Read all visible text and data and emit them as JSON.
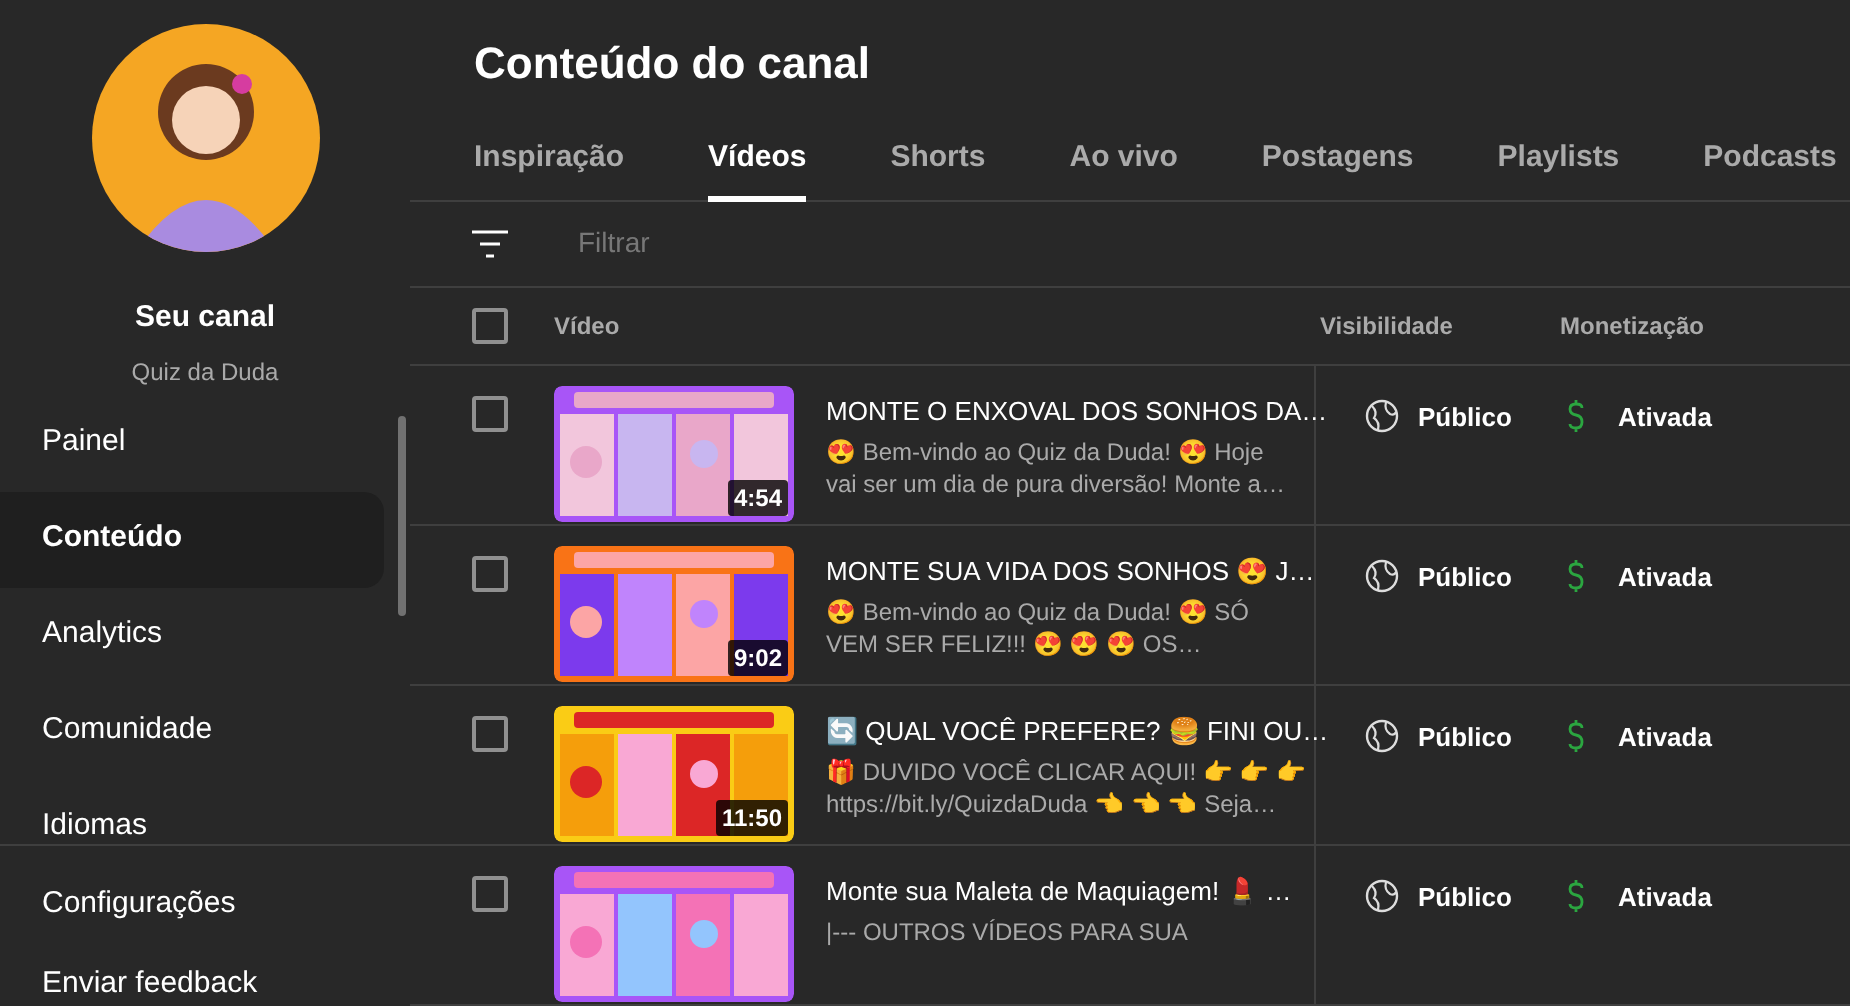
{
  "sidebar": {
    "channel_title": "Seu canal",
    "channel_name": "Quiz da Duda",
    "items": [
      {
        "label": "Painel",
        "selected": false
      },
      {
        "label": "Conteúdo",
        "selected": true
      },
      {
        "label": "Analytics",
        "selected": false
      },
      {
        "label": "Comunidade",
        "selected": false
      },
      {
        "label": "Idiomas",
        "selected": false
      }
    ],
    "footer_items": [
      "Configurações",
      "Enviar feedback"
    ]
  },
  "page_title": "Conteúdo do canal",
  "tabs": [
    {
      "label": "Inspiração",
      "selected": false
    },
    {
      "label": "Vídeos",
      "selected": true
    },
    {
      "label": "Shorts",
      "selected": false
    },
    {
      "label": "Ao vivo",
      "selected": false
    },
    {
      "label": "Postagens",
      "selected": false
    },
    {
      "label": "Playlists",
      "selected": false
    },
    {
      "label": "Podcasts",
      "selected": false
    }
  ],
  "filter": {
    "placeholder": "Filtrar"
  },
  "table": {
    "select_all_checked": false,
    "columns": [
      "Vídeo",
      "Visibilidade",
      "Monetização"
    ],
    "rows": [
      {
        "checked": false,
        "duration": "4:54",
        "title": "MONTE O ENXOVAL DOS SONHOS DA…",
        "description": "😍 Bem-vindo ao Quiz da Duda! 😍 Hoje\nvai ser um dia de pura diversão! Monte a…",
        "visibility": "Público",
        "monetization": "Ativada"
      },
      {
        "checked": false,
        "duration": "9:02",
        "title": "MONTE SUA VIDA DOS SONHOS 😍 J…",
        "description": "😍 Bem-vindo ao Quiz da Duda! 😍 SÓ\nVEM SER FELIZ!!! 😍 😍 😍 OS…",
        "visibility": "Público",
        "monetization": "Ativada"
      },
      {
        "checked": false,
        "duration": "11:50",
        "title": "🔄 QUAL VOCÊ PREFERE? 🍔 FINI OU…",
        "description": "🎁 DUVIDO VOCÊ CLICAR AQUI! 👉 👉 👉\nhttps://bit.ly/QuizdaDuda 👈 👈 👈 Seja…",
        "visibility": "Público",
        "monetization": "Ativada"
      },
      {
        "checked": false,
        "title": "Monte sua Maleta de Maquiagem! 💄 …",
        "description": "|--- OUTROS VÍDEOS PARA SUA",
        "visibility": "Público",
        "monetization": "Ativada"
      }
    ]
  }
}
